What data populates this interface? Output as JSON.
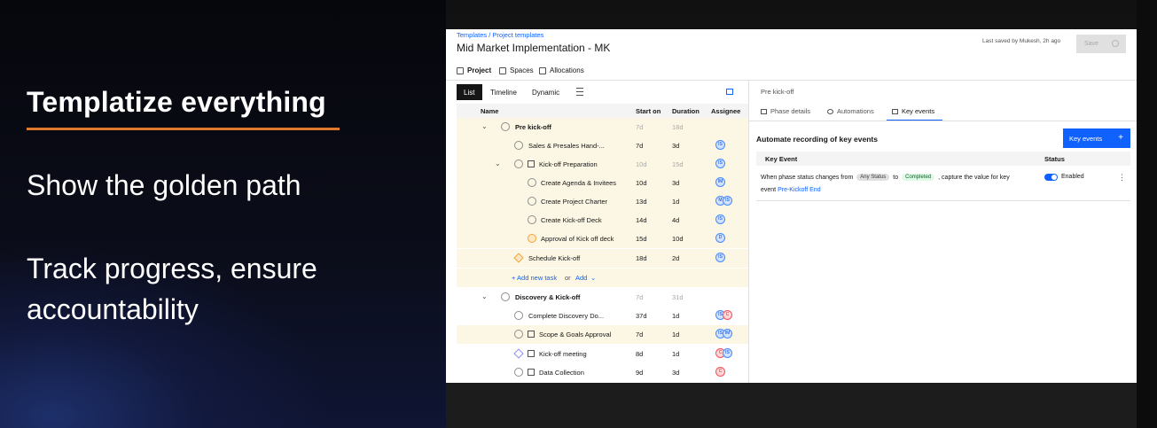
{
  "slide": {
    "title": "Templatize everything",
    "bullets": [
      "Show the golden path",
      "Track progress, ensure",
      "accountability"
    ],
    "accent_color": "#e07a2a"
  },
  "app": {
    "breadcrumb": "Templates / Project templates",
    "page_title": "Mid Market Implementation - MK",
    "last_saved": "Last saved by Mukesh, 2h ago",
    "save_label": "Save",
    "tabs": [
      {
        "label": "Project",
        "icon": "project-icon"
      },
      {
        "label": "Spaces",
        "icon": "spaces-icon"
      },
      {
        "label": "Allocations",
        "icon": "allocations-icon"
      }
    ],
    "views": {
      "list": "List",
      "timeline": "Timeline",
      "dynamic": "Dynamic"
    },
    "table": {
      "columns": {
        "name": "Name",
        "start": "Start on",
        "duration": "Duration",
        "assignee": "Assignee"
      },
      "rows": [
        {
          "name": "Pre kick-off",
          "start": "7d",
          "duration": "18d",
          "assignees": []
        },
        {
          "name": "Sales & Presales Hand-...",
          "start": "7d",
          "duration": "3d",
          "assignees": [
            "IS"
          ]
        },
        {
          "name": "Kick-off Preparation",
          "start": "10d",
          "duration": "15d",
          "assignees": [
            "IS"
          ]
        },
        {
          "name": "Create Agenda & Invitees",
          "start": "10d",
          "duration": "3d",
          "assignees": [
            "IM"
          ]
        },
        {
          "name": "Create Project Charter",
          "start": "13d",
          "duration": "1d",
          "assignees": [
            "M",
            "IS"
          ]
        },
        {
          "name": "Create Kick-off Deck",
          "start": "14d",
          "duration": "4d",
          "assignees": [
            "IS"
          ]
        },
        {
          "name": "Approval of Kick off deck",
          "start": "15d",
          "duration": "10d",
          "assignees": [
            "D"
          ]
        },
        {
          "name": "Schedule Kick-off",
          "start": "18d",
          "duration": "2d",
          "assignees": [
            "IS"
          ]
        },
        {
          "name": "Discovery & Kick-off",
          "start": "7d",
          "duration": "31d",
          "assignees": []
        },
        {
          "name": "Complete Discovery Do...",
          "start": "37d",
          "duration": "1d",
          "assignees": [
            "IS",
            "C"
          ]
        },
        {
          "name": "Scope & Goals Approval",
          "start": "7d",
          "duration": "1d",
          "assignees": [
            "IS",
            "IM"
          ]
        },
        {
          "name": "Kick-off meeting",
          "start": "8d",
          "duration": "1d",
          "assignees": [
            "C",
            "IS"
          ]
        },
        {
          "name": "Data Collection",
          "start": "9d",
          "duration": "3d",
          "assignees": [
            "C"
          ]
        }
      ],
      "add_new_task": "+ Add new task",
      "or": "or",
      "add": "Add"
    },
    "detail": {
      "title": "Pre kick-off",
      "tabs": [
        "Phase details",
        "Automations",
        "Key events"
      ],
      "heading": "Automate recording of key events",
      "key_events_button": "Key events",
      "columns": {
        "event": "Key Event",
        "status": "Status"
      },
      "event": {
        "text_start": "When phase status changes from",
        "from_tag": "Any Status",
        "to_word": "to",
        "to_tag": "Completed",
        "text_end": ", capture the value for key",
        "line2_start": "event",
        "link": "Pre-Kickoff End",
        "status": "Enabled"
      }
    }
  }
}
